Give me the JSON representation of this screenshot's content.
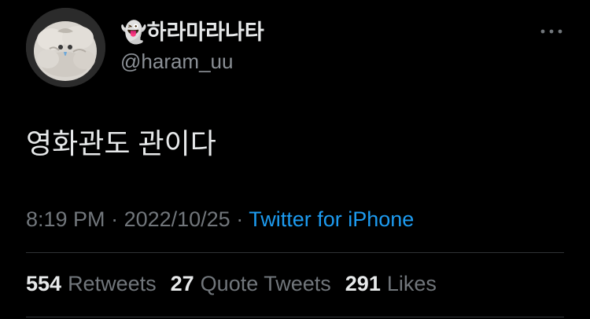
{
  "user": {
    "display_name": "👻하라마라나타",
    "handle": "@haram_uu"
  },
  "tweet": {
    "text": "영화관도 관이다",
    "time": "8:19 PM",
    "separator1": " · ",
    "date": "2022/10/25",
    "separator2": " · ",
    "source": "Twitter for iPhone"
  },
  "stats": {
    "retweets_count": "554",
    "retweets_label": "Retweets",
    "quotes_count": "27",
    "quotes_label": "Quote Tweets",
    "likes_count": "291",
    "likes_label": "Likes"
  },
  "icons": {
    "more": "more-horizontal-icon"
  },
  "colors": {
    "background": "#000000",
    "primary_text": "#e7e9ea",
    "secondary_text": "#71767b",
    "link": "#1d9bf0",
    "divider": "#2f3336"
  }
}
